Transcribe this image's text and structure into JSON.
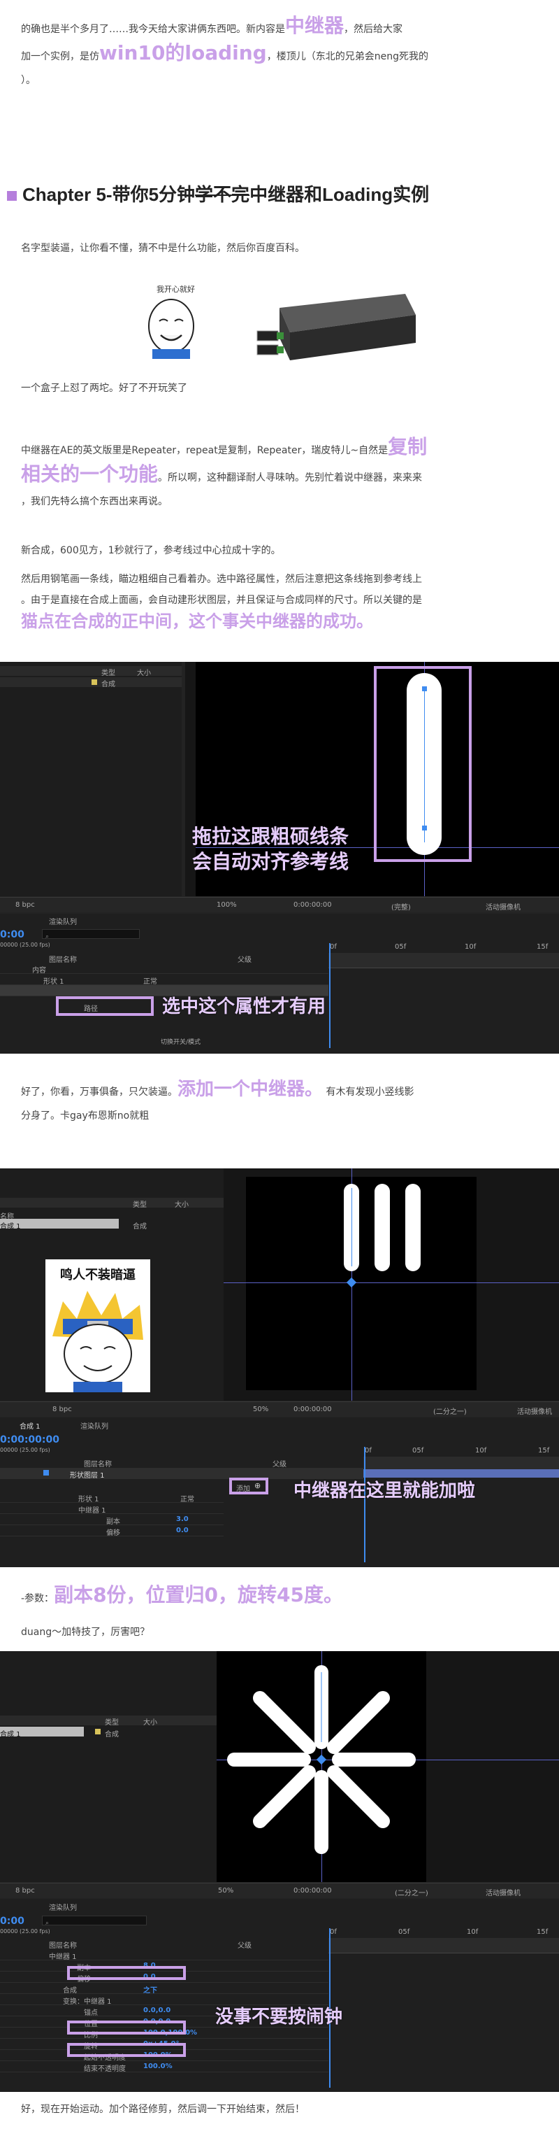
{
  "intro": {
    "line1_a": "的确也是半个多月了……我今天给大家讲俩东西吧。新内容是",
    "line1_hl": "中继器",
    "line1_b": "，然后给大家",
    "line2_a": "加一个实例，是仿",
    "line2_hl": "win10的loading",
    "line2_b": "，楼顶儿（东北的兄弟会neng死我的",
    "line3": "）。"
  },
  "chapter": {
    "prefix": "Chapter 5-带你5分钟",
    "strike": "学不完",
    "suffix": "中继器和Loading实例"
  },
  "p_naming": "名字型装逼，让你看不懂，猜不中是什么功能，然后你百度百科。",
  "meme1_caption": "我开心就好",
  "p_box": "一个盒子上怼了两坨。好了不开玩笑了",
  "p_repeater": {
    "a": "中继器在AE的英文版里是Repeater，repeat是复制，Repeater，瑞皮特儿~自然是",
    "hl1": "复制",
    "hl2": "相关的一个功能",
    "b": "。所以啊，这种翻译耐人寻味呐。先别忙着说中继器，来来来",
    "c": "，我们先特么搞个东西出来再说。"
  },
  "p_comp": "新合成，600见方，1秒就行了，参考线过中心拉成十字的。",
  "p_pen": {
    "a": "然后用钢笔画一条线，瞄边粗细自己看着办。选中路径属性，然后注意把这条线拖到参考线上",
    "b": "。由于是直接在合成上面画，会自动建形状图层，并且保证与合成同样的尺寸。所以关键的是",
    "hl": "猫点在合成的正中间，这个事关中继器的成功。"
  },
  "shot1": {
    "project_header_type": "类型",
    "project_header_size": "大小",
    "project_item_type": "合成",
    "annot": "拖拉这跟粗硕线条\n会自动对齐参考线",
    "zoom": "100%",
    "time": "0:00:00:00",
    "quality": "(完整)",
    "camera": "活动摄像机",
    "bpc": "8 bpc",
    "render_queue": "渲染队列",
    "time_display": "0:00",
    "fps": "00000 (25.00 fps)",
    "col_layer_name": "图层名称",
    "col_parent": "父级",
    "row_contents": "内容",
    "row_shape": "形状 1",
    "row_mode": "正常",
    "row_path": "路径",
    "toggle": "切换开关/模式",
    "ruler": [
      "0f",
      "05f",
      "10f",
      "15f"
    ],
    "annot2": "选中这个属性才有用"
  },
  "p_add": {
    "a": "好了，你看，万事俱备，只欠装逼。",
    "hl": "添加一个中继器。",
    "b": "有木有发现小竖线影",
    "c": "分身了。卡gay布恩斯no就粗"
  },
  "shot2": {
    "project_header_type": "类型",
    "project_header_size": "大小",
    "col_name": "名称",
    "item_name": "合成 1",
    "item_type": "合成",
    "meme_caption": "鸣人不装暗逼",
    "zoom": "50%",
    "time": "0:00:00:00",
    "view": "(二分之一)",
    "camera": "活动摄像机",
    "bpc": "8 bpc",
    "tab_comp": "合成 1",
    "render_queue": "渲染队列",
    "time_display": "0:00:00:00",
    "fps": "00000 (25.00 fps)",
    "col_layer_name": "图层名称",
    "col_parent": "父级",
    "layer_name": "形状图层 1",
    "add_label": "添加",
    "row_shape": "形状 1",
    "row_mode": "正常",
    "row_repeater": "中继器 1",
    "row_copies": "副本",
    "row_copies_val": "3.0",
    "row_offset": "偏移",
    "row_offset_val": "0.0",
    "ruler": [
      "0f",
      "05f",
      "10f",
      "15f"
    ],
    "annot": "中继器在这里就能加啦"
  },
  "p_params": {
    "prefix": "-参数：",
    "hl": "副本8份，位置归0，旋转45度。"
  },
  "p_duang": "duang～加特技了，厉害吧？",
  "shot3": {
    "project_header_type": "类型",
    "project_header_size": "大小",
    "item_name": "合成 1",
    "item_type": "合成",
    "zoom": "50%",
    "time": "0:00:00:00",
    "view": "(二分之一)",
    "camera": "活动摄像机",
    "bpc": "8 bpc",
    "render_queue": "渲染队列",
    "time_display": "0:00",
    "fps": "00000 (25.00 fps)",
    "col_layer_name": "图层名称",
    "col_parent": "父级",
    "rows": [
      {
        "label": "中继器 1",
        "value": ""
      },
      {
        "label": "副本",
        "value": "8.0"
      },
      {
        "label": "偏移",
        "value": "0.0"
      },
      {
        "label": "合成",
        "value": "之下"
      },
      {
        "label": "变换：中继器 1",
        "value": ""
      },
      {
        "label": "锚点",
        "value": "0.0,0.0"
      },
      {
        "label": "位置",
        "value": "0.0,0.0"
      },
      {
        "label": "比例",
        "value": "100.0,100.0%"
      },
      {
        "label": "旋转",
        "value": "0x+45.0°"
      },
      {
        "label": "起始不透明度",
        "value": "100.0%"
      },
      {
        "label": "结束不透明度",
        "value": "100.0%"
      }
    ],
    "ruler": [
      "0f",
      "05f",
      "10f",
      "15f"
    ],
    "annot": "没事不要按闹钟"
  },
  "p_final": "好，现在开始运动。加个路径修剪，然后调一下开始结束，然后！"
}
